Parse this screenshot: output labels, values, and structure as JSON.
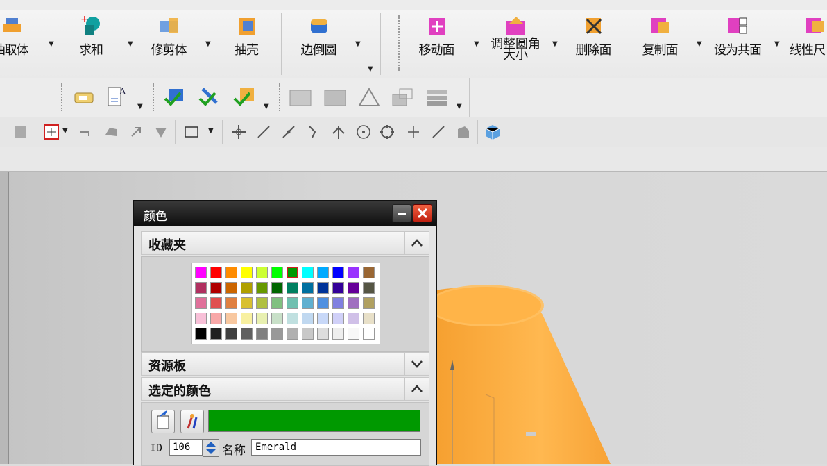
{
  "ribbon": {
    "buttons": [
      {
        "label": "抽取体"
      },
      {
        "label": "求和"
      },
      {
        "label": "修剪体"
      },
      {
        "label": "抽壳"
      },
      {
        "label": "边倒圆"
      },
      {
        "label": "移动面"
      },
      {
        "label": "调整圆角",
        "label2": "大小"
      },
      {
        "label": "删除面"
      },
      {
        "label": "复制面"
      },
      {
        "label": "设为共面"
      },
      {
        "label": "线性尺"
      }
    ]
  },
  "dialog": {
    "title": "颜色",
    "sections": {
      "favorites": "收藏夹",
      "palette": "资源板",
      "selected": "选定的颜色"
    },
    "palette_rows": [
      [
        "#ff00ff",
        "#ff0000",
        "#ff8c00",
        "#ffff00",
        "#ccff33",
        "#00ff00",
        "#009900",
        "#00ffff",
        "#00aaff",
        "#0000ff",
        "#9933ff",
        "#996633"
      ],
      [
        "#b03060",
        "#b00000",
        "#cc6600",
        "#b0a000",
        "#669900",
        "#006600",
        "#008060",
        "#0070a0",
        "#003399",
        "#330099",
        "#660099",
        "#555544"
      ],
      [
        "#e0709a",
        "#e05050",
        "#e08040",
        "#d8c030",
        "#b0c040",
        "#80c080",
        "#70c0b0",
        "#60b0d0",
        "#5090e0",
        "#8080e0",
        "#a070c0",
        "#b0a060"
      ],
      [
        "#f8c0d8",
        "#f8a8a8",
        "#f8c8a0",
        "#f8f0a0",
        "#e8f0b0",
        "#c8e0c8",
        "#c0e0e0",
        "#c0d8f0",
        "#c8d8f8",
        "#d0d0f8",
        "#d0c0e8",
        "#e8e0c8"
      ],
      [
        "#000000",
        "#202020",
        "#404040",
        "#606060",
        "#808080",
        "#999999",
        "#b0b0b0",
        "#c8c8c8",
        "#dddddd",
        "#eeeeee",
        "#f8f8f8",
        "#ffffff"
      ]
    ],
    "selected_color": "#009900",
    "id_label": "ID",
    "id_value": "106",
    "name_label": "名称",
    "name_value": "Emerald"
  }
}
